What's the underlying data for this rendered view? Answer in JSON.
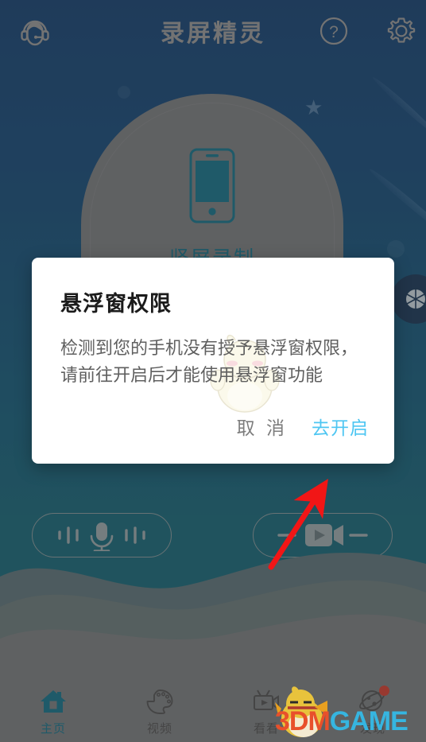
{
  "app": {
    "title": "录屏精灵"
  },
  "header": {
    "support_icon": "headset-support-icon",
    "help_icon": "help-circle-icon",
    "settings_icon": "gear-icon"
  },
  "main": {
    "record_card": {
      "label": "竖屏录制",
      "icon": "phone-portrait-icon"
    },
    "floating_bubble_icon": "camera-shutter-icon",
    "buttons": [
      {
        "name": "microphone-toggle",
        "icon": "microphone-waves-icon"
      },
      {
        "name": "video-record-toggle",
        "icon": "video-camera-icon"
      }
    ]
  },
  "dialog": {
    "title": "悬浮窗权限",
    "message": "检测到您的手机没有授予悬浮窗权限，请前往开启后才能使用悬浮窗功能",
    "cancel_label": "取 消",
    "confirm_label": "去开启",
    "confirm_color": "#4ec6f2",
    "cancel_color": "#7d7d7d"
  },
  "annotation": {
    "arrow_color": "#f11616",
    "arrow_points_to": "去开启"
  },
  "bottom_nav": {
    "items": [
      {
        "label": "主页",
        "icon": "home-icon",
        "active": true,
        "badge": false
      },
      {
        "label": "视频",
        "icon": "palette-icon",
        "active": false,
        "badge": false
      },
      {
        "label": "看看",
        "icon": "tv-video-icon",
        "active": false,
        "badge": false
      },
      {
        "label": "发现",
        "icon": "planet-icon",
        "active": false,
        "badge": true
      }
    ],
    "active_color": "#14687d",
    "inactive_color": "#4a4a4a"
  },
  "watermark": {
    "text_primary": "3DM",
    "text_secondary": "GAME",
    "primary_color": "#e8502b",
    "secondary_color": "#36b5e0",
    "mascot_icon": "chick-mascot-icon"
  },
  "theme": {
    "background_top": "#133c68",
    "background_bottom": "#165f6e",
    "card_color": "#6f7173",
    "accent_teal": "#14687d"
  }
}
